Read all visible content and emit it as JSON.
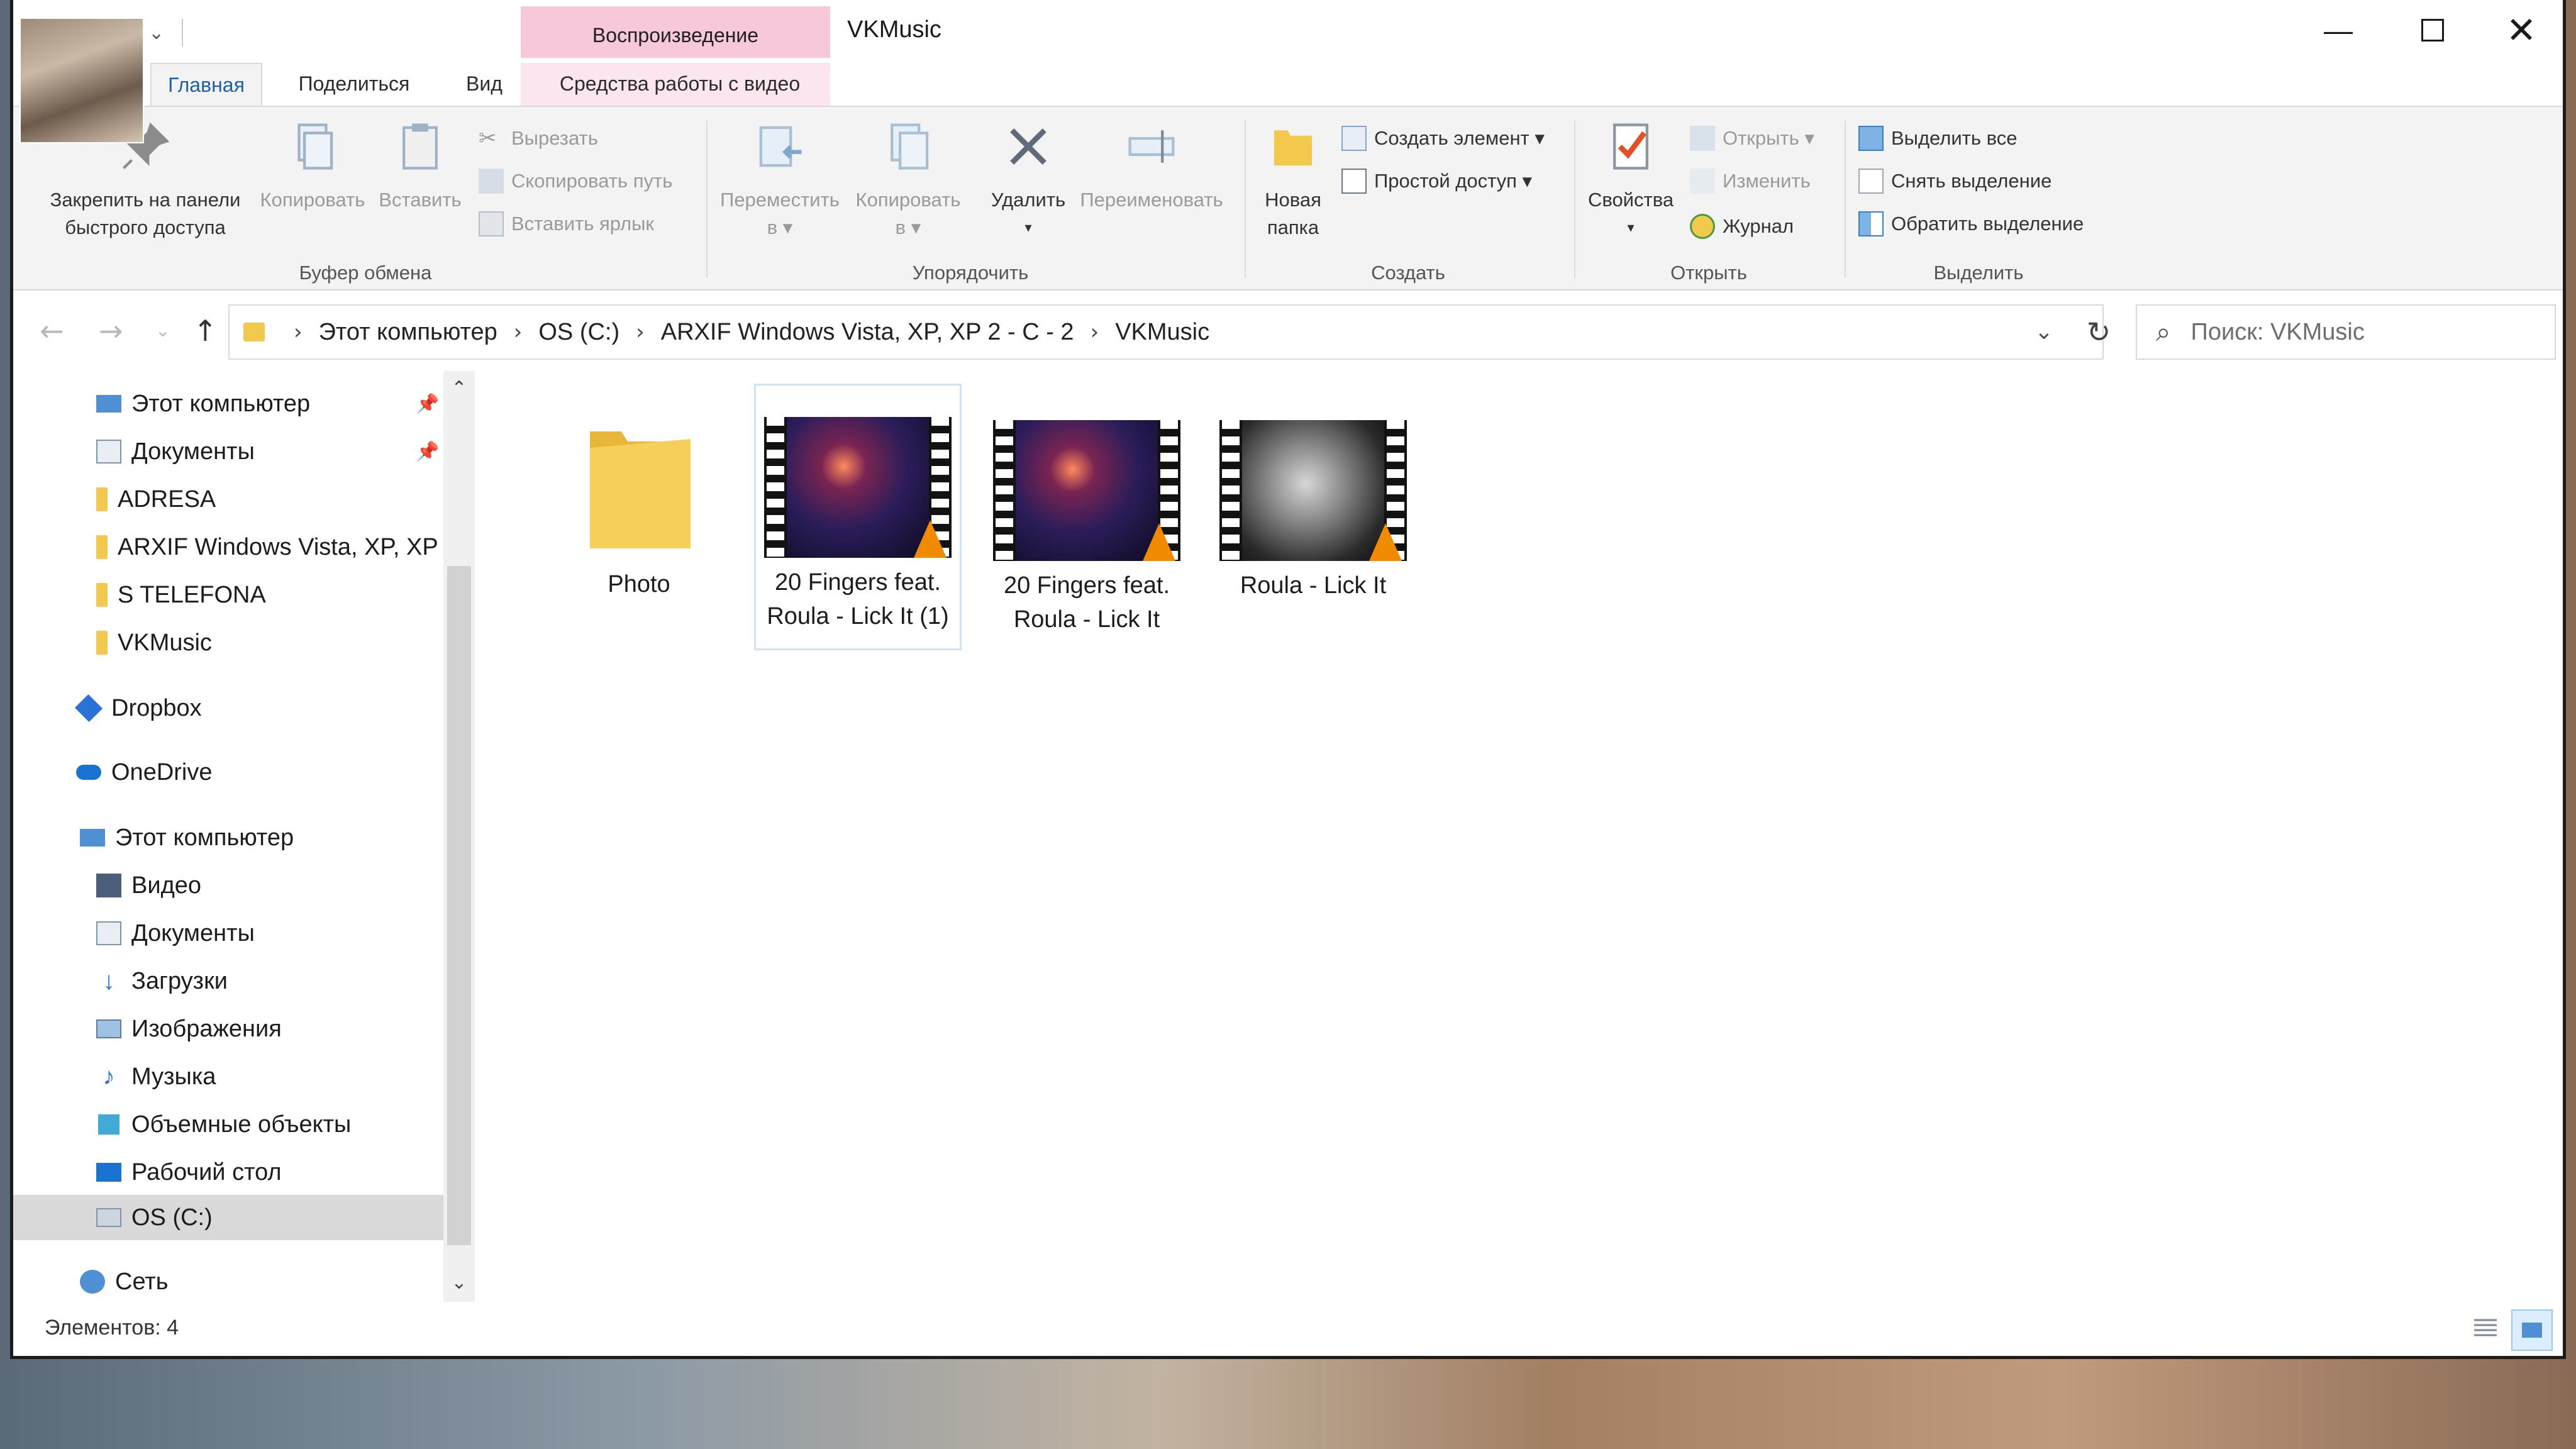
{
  "window": {
    "title": "VKMusic",
    "context_tab_header": "Воспроизведение"
  },
  "tabs": [
    "Главная",
    "Поделиться",
    "Вид",
    "Средства работы с видео"
  ],
  "ribbon": {
    "clipboard": {
      "pin_label_1": "Закрепить на панели",
      "pin_label_2": "быстрого доступа",
      "copy": "Копировать",
      "paste": "Вставить",
      "cut": "Вырезать",
      "copy_path": "Скопировать путь",
      "paste_shortcut": "Вставить ярлык",
      "group": "Буфер обмена"
    },
    "organize": {
      "move_to_1": "Переместить",
      "move_to_2": "в ▾",
      "copy_to_1": "Копировать",
      "copy_to_2": "в ▾",
      "delete": "Удалить",
      "rename": "Переименовать",
      "group": "Упорядочить"
    },
    "create": {
      "new_folder_1": "Новая",
      "new_folder_2": "папка",
      "new_item": "Создать элемент ▾",
      "easy_access": "Простой доступ ▾",
      "group": "Создать"
    },
    "open": {
      "properties": "Свойства",
      "open": "Открыть ▾",
      "edit": "Изменить",
      "history": "Журнал",
      "group": "Открыть"
    },
    "select": {
      "select_all": "Выделить все",
      "select_none": "Снять выделение",
      "invert": "Обратить выделение",
      "group": "Выделить"
    }
  },
  "address": {
    "crumbs": [
      "Этот компьютер",
      "OS (C:)",
      "ARXIF Windows Vista, XP, XP 2 - C - 2",
      "VKMusic"
    ],
    "search_placeholder": "Поиск: VKMusic"
  },
  "nav": {
    "quick": [
      {
        "label": "Этот компьютер",
        "icon": "computer-icon"
      },
      {
        "label": "Документы",
        "icon": "documents-icon"
      },
      {
        "label": "ADRESA",
        "icon": "folder-icon"
      },
      {
        "label": "ARXIF Windows Vista, XP, XP 2",
        "icon": "folder-icon"
      },
      {
        "label": "S TELEFONA",
        "icon": "folder-icon"
      },
      {
        "label": "VKMusic",
        "icon": "folder-icon"
      }
    ],
    "dropbox": "Dropbox",
    "onedrive": "OneDrive",
    "this_pc": "Этот компьютер",
    "pc_items": [
      {
        "label": "Видео",
        "icon": "video-icon"
      },
      {
        "label": "Документы",
        "icon": "documents-icon"
      },
      {
        "label": "Загрузки",
        "icon": "downloads-icon"
      },
      {
        "label": "Изображения",
        "icon": "pictures-icon"
      },
      {
        "label": "Музыка",
        "icon": "music-icon"
      },
      {
        "label": "Объемные объекты",
        "icon": "3d-objects-icon"
      },
      {
        "label": "Рабочий стол",
        "icon": "desktop-icon"
      },
      {
        "label": "OS (C:)",
        "icon": "drive-icon"
      }
    ],
    "network": "Сеть"
  },
  "files": [
    {
      "line1": "Photo",
      "line2": "",
      "type": "folder"
    },
    {
      "line1": "20 Fingers feat.",
      "line2": "Roula - Lick It (1)",
      "type": "video"
    },
    {
      "line1": "20 Fingers feat.",
      "line2": "Roula - Lick It",
      "type": "video"
    },
    {
      "line1": "Roula - Lick It",
      "line2": "",
      "type": "video"
    }
  ],
  "status": {
    "count": "Элементов: 4"
  },
  "colors": {
    "context_tab": "#f6c8da",
    "accent": "#1a73d0",
    "folder": "#f2c94c",
    "selection": "#cde4f7"
  }
}
